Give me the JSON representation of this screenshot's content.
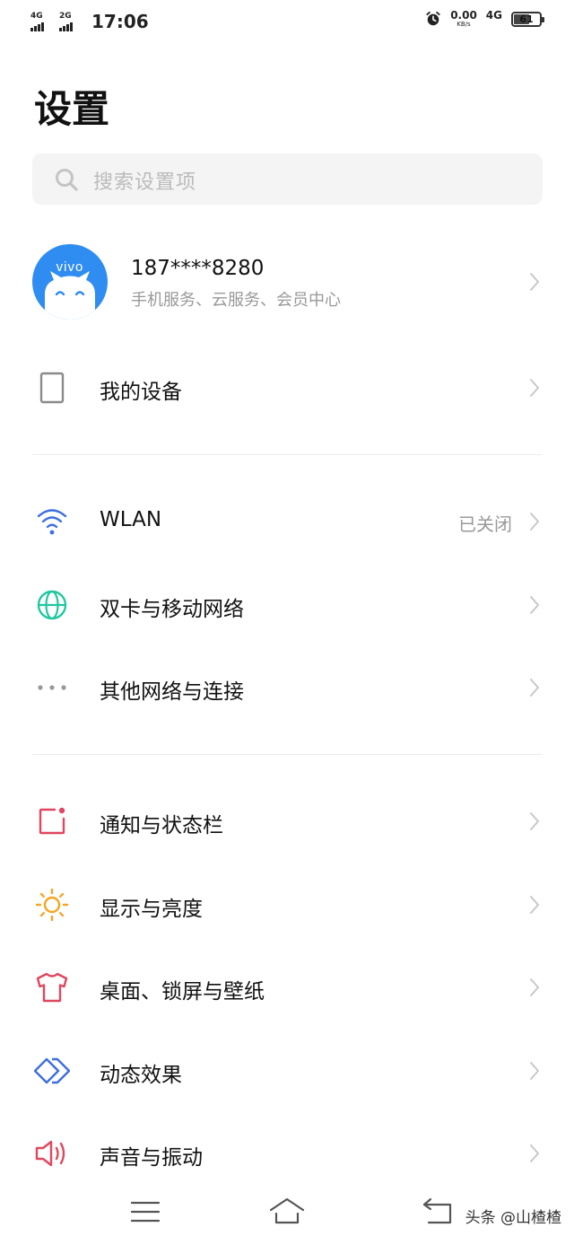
{
  "status_bar": {
    "sim1_network": "4G",
    "sim2_network": "2G",
    "time": "17:06",
    "net_speed": "0.00",
    "net_speed_unit": "KB/s",
    "mobile_data": "4G",
    "battery": "61"
  },
  "header": {
    "title": "设置"
  },
  "search": {
    "placeholder": "搜索设置项"
  },
  "account": {
    "avatar_label": "vivo",
    "number": "187****8280",
    "subtitle": "手机服务、云服务、会员中心"
  },
  "groups": [
    {
      "items": [
        {
          "label": "我的设备",
          "icon": "device-icon"
        }
      ]
    },
    {
      "items": [
        {
          "label": "WLAN",
          "value": "已关闭",
          "icon": "wifi-icon",
          "color": "#3d6ee0"
        },
        {
          "label": "双卡与移动网络",
          "icon": "globe-icon",
          "color": "#22c7a0"
        },
        {
          "label": "其他网络与连接",
          "icon": "more-dots-icon",
          "color": "#999999"
        }
      ]
    },
    {
      "items": [
        {
          "label": "通知与状态栏",
          "icon": "notification-icon",
          "color": "#e0475f"
        },
        {
          "label": "显示与亮度",
          "icon": "sun-icon",
          "color": "#f5a623"
        },
        {
          "label": "桌面、锁屏与壁纸",
          "icon": "tshirt-icon",
          "color": "#e0475f"
        },
        {
          "label": "动态效果",
          "icon": "diamond-icon",
          "color": "#3d6ee0"
        },
        {
          "label": "声音与振动",
          "icon": "speaker-icon",
          "color": "#e0475f"
        }
      ]
    }
  ],
  "navbar": {
    "menu_icon": "menu-icon",
    "home_icon": "home-icon",
    "back_icon": "back-icon",
    "watermark": "头条 @山楂楂"
  }
}
